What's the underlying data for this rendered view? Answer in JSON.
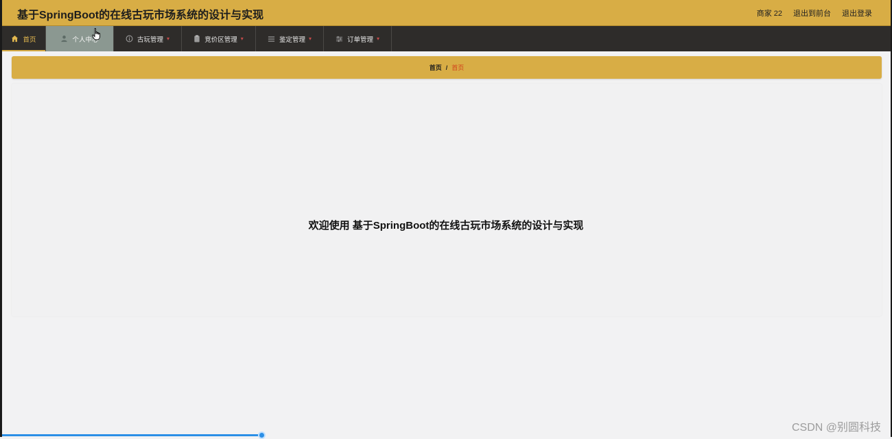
{
  "header": {
    "title": "基于SpringBoot的在线古玩市场系统的设计与实现",
    "user_label": "商家 22",
    "to_frontend": "退出到前台",
    "logout": "退出登录"
  },
  "nav": {
    "items": [
      {
        "label": "首页",
        "icon": "home-icon",
        "state": "active"
      },
      {
        "label": "个人中心",
        "icon": "user-icon",
        "state": "hover"
      },
      {
        "label": "古玩管理",
        "icon": "info-icon",
        "has_menu": true
      },
      {
        "label": "竞价区管理",
        "icon": "clipboard-icon",
        "has_menu": true
      },
      {
        "label": "鉴定管理",
        "icon": "list-icon",
        "has_menu": true
      },
      {
        "label": "订单管理",
        "icon": "sliders-icon",
        "has_menu": true
      }
    ]
  },
  "breadcrumb": {
    "root": "首页",
    "separator": "/",
    "current": "首页"
  },
  "main": {
    "welcome": "欢迎使用 基于SpringBoot的在线古玩市场系统的设计与实现"
  },
  "watermark": "CSDN @别圆科技",
  "player": {
    "progress_percent": 29.2
  },
  "colors": {
    "accent": "#d8ad45",
    "nav_bg": "#2e2c2a",
    "hover_bg": "#8b9891",
    "breadcrumb_current": "#d2421c",
    "progress": "#2b8fe6"
  }
}
